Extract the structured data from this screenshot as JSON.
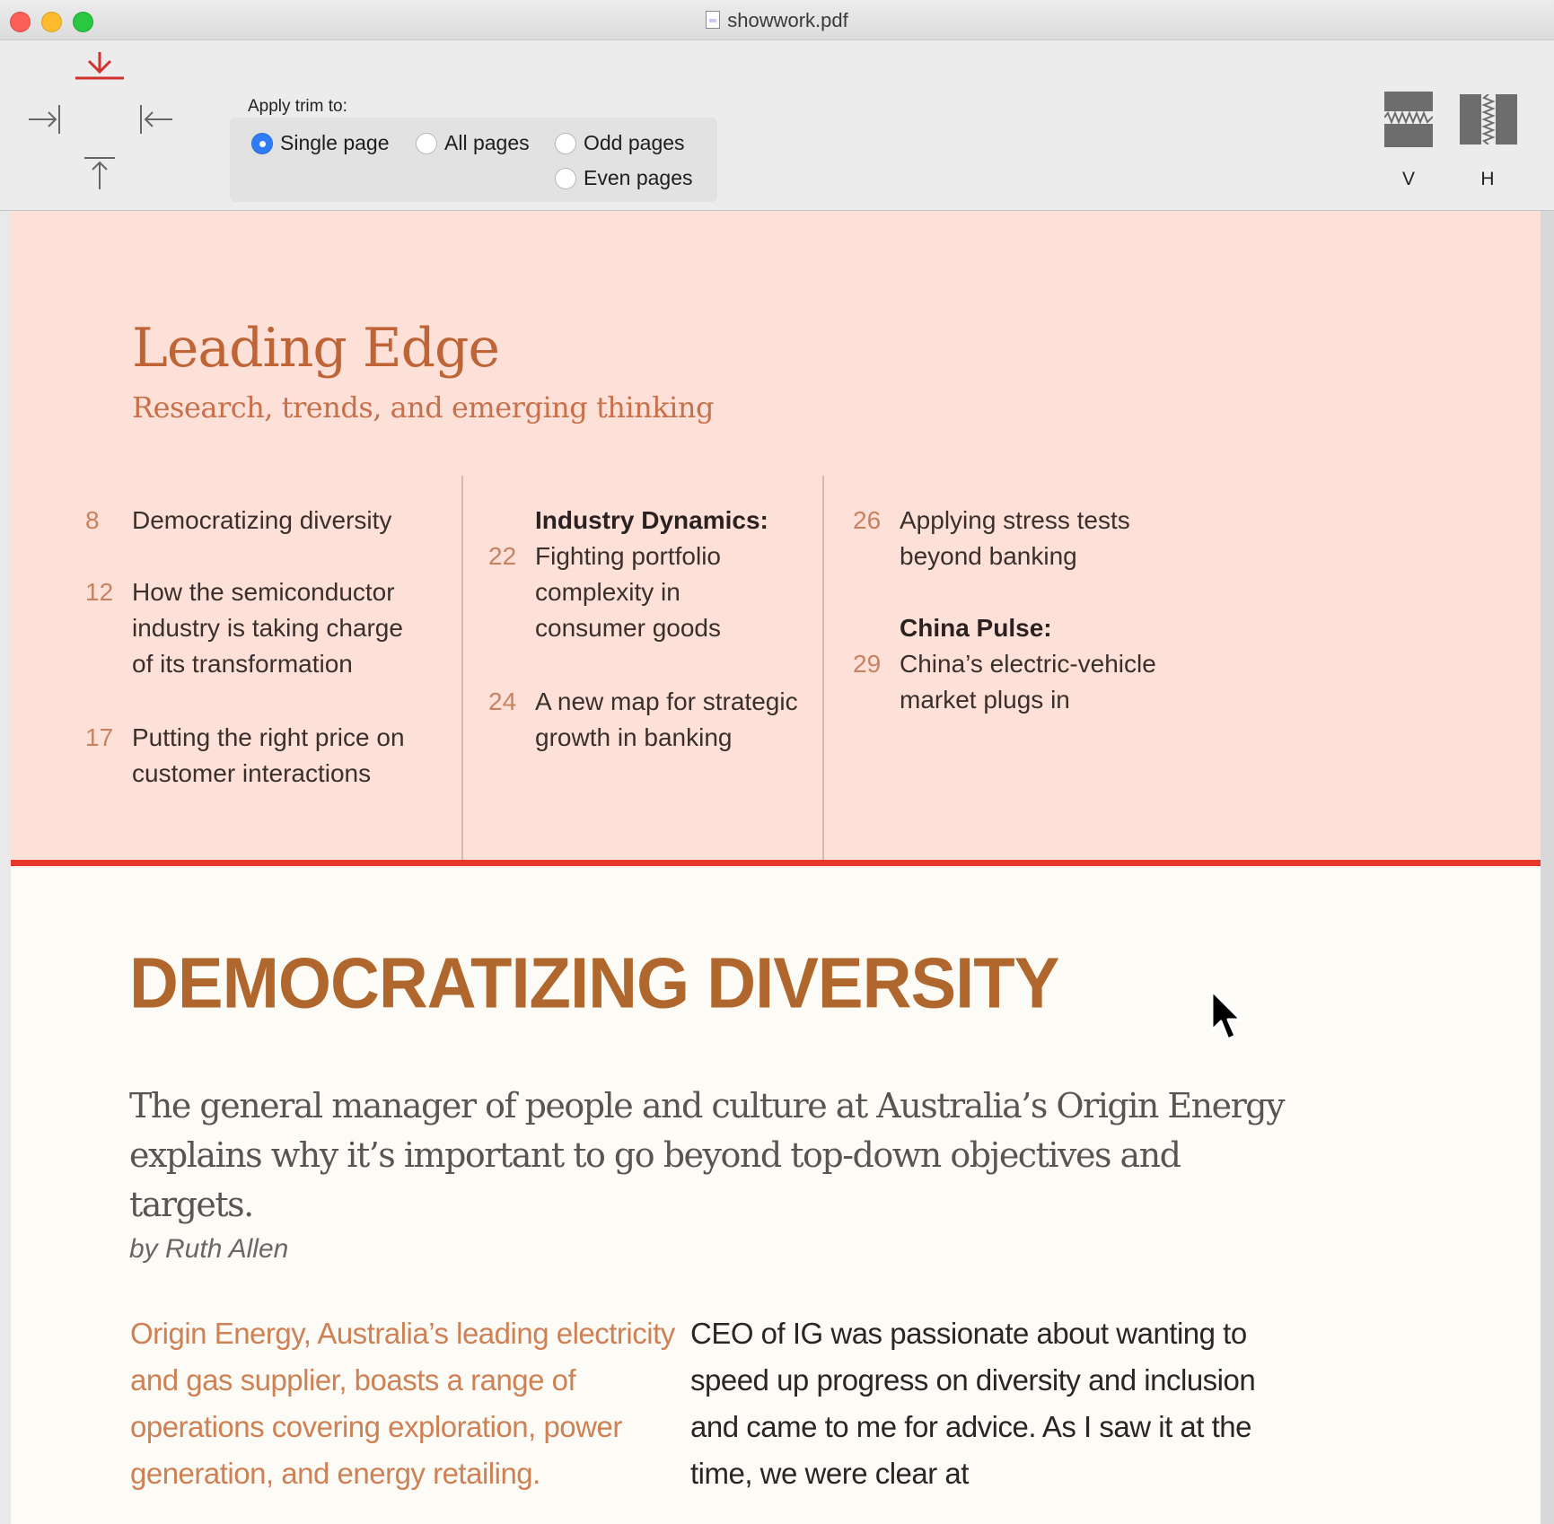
{
  "window": {
    "title": "showwork.pdf"
  },
  "toolbar": {
    "apply_label": "Apply trim to:",
    "options": [
      {
        "label": "Single page",
        "selected": true
      },
      {
        "label": "All pages",
        "selected": false
      },
      {
        "label": "Odd pages",
        "selected": false
      },
      {
        "label": "Even pages",
        "selected": false
      }
    ],
    "split_vertical_label": "V",
    "split_horizontal_label": "H",
    "accent_color": "#d0312d"
  },
  "page": {
    "section_title": "Leading Edge",
    "section_subtitle": "Research, trends, and emerging thinking",
    "toc": {
      "col1": [
        {
          "num": "8",
          "text": "Democratizing diversity"
        },
        {
          "num": "12",
          "text": "How the semiconductor industry is taking charge of its transformation"
        },
        {
          "num": "17",
          "text": "Putting the right price on customer interactions"
        }
      ],
      "col2": {
        "heading": "Industry Dynamics:",
        "items": [
          {
            "num": "22",
            "text": "Fighting portfolio complexity in consumer goods"
          },
          {
            "num": "24",
            "text": "A new map for strategic growth in banking"
          }
        ]
      },
      "col3": {
        "items_top": [
          {
            "num": "26",
            "text": "Applying stress tests beyond banking"
          }
        ],
        "heading": "China Pulse:",
        "items_bottom": [
          {
            "num": "29",
            "text": "China’s electric-vehicle market plugs in"
          }
        ]
      }
    },
    "article": {
      "title": "DEMOCRATIZING DIVERSITY",
      "deck": "The general manager of people and culture at Australia’s Origin Energy explains why it’s important to go beyond top-down objectives and targets.",
      "byline": "by Ruth Allen",
      "intro": "Origin Energy, Australia’s leading electricity and gas supplier, boasts a range of operations covering exploration, power generation, and energy retailing.",
      "body": "CEO of IG was passionate about wanting to speed up progress on diversity and inclusion and came to me for advice. As I saw it at the time, we were clear at"
    },
    "colors": {
      "pink_bg": "#fde1d9",
      "divider_red": "#e8372c",
      "title_brown": "#b0672d",
      "accent_orange": "#c7704a"
    }
  }
}
